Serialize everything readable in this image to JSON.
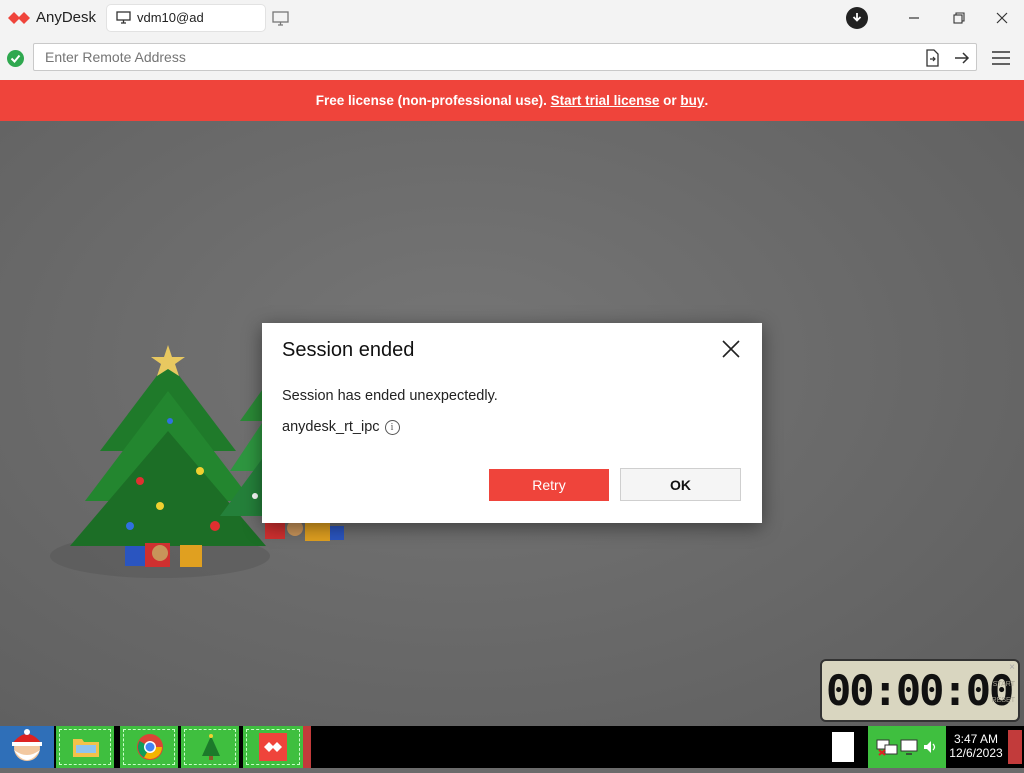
{
  "app": {
    "name": "AnyDesk",
    "tab_label": "vdm10@ad"
  },
  "address_bar": {
    "placeholder": "Enter Remote Address"
  },
  "banner": {
    "prefix": "Free license (non-professional use). ",
    "trial_link": "Start trial license",
    "middle": " or ",
    "buy_link": "buy",
    "suffix": "."
  },
  "dialog": {
    "title": "Session ended",
    "message": "Session has ended unexpectedly.",
    "error_code": "anydesk_rt_ipc",
    "retry_label": "Retry",
    "ok_label": "OK"
  },
  "timer": {
    "display": "00:00:00",
    "start_label": "START",
    "reset_label": "RESET",
    "close": "×"
  },
  "taskbar": {
    "time": "3:47 AM",
    "date": "12/6/2023"
  },
  "colors": {
    "accent": "#ef443b",
    "taskbar_green": "#3fbf3f",
    "status_ok": "#2fa84f"
  }
}
